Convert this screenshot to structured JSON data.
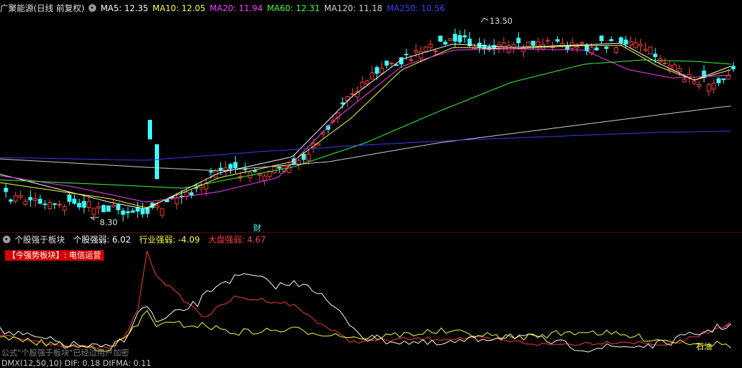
{
  "header": {
    "title": "广聚能源(日线 前复权)",
    "ma": [
      {
        "label": "MA5: 12.35",
        "color": "#ffffff"
      },
      {
        "label": "MA10: 12.05",
        "color": "#ffff3c"
      },
      {
        "label": "MA20: 11.94",
        "color": "#ff3cff"
      },
      {
        "label": "MA60: 12.31",
        "color": "#3cff3c"
      },
      {
        "label": "MA120: 11.18",
        "color": "#cfcfcf"
      },
      {
        "label": "MA250: 10.56",
        "color": "#3c3cff"
      }
    ]
  },
  "main_chart": {
    "high_label": "13.50",
    "low_label": "8.30",
    "event_marker": "财"
  },
  "sub_header": {
    "name": "个股强于板块",
    "items": [
      {
        "label": "个股强弱: 6.02",
        "color": "#ffffff"
      },
      {
        "label": "行业强弱: -4.09",
        "color": "#ffff3c"
      },
      {
        "label": "大盘强弱: 4.67",
        "color": "#ff3c3c"
      }
    ]
  },
  "sub_chart": {
    "badge": "【今强势板块】: 电信运营",
    "tag": "石油",
    "formula_note": "公式\"个股强于板块\"已经过用户加密"
  },
  "bottom": {
    "macd": "DMX(12,50,10)  DIF: 0.18  DIFMA: 0.11"
  },
  "colors": {
    "up": "#ff3c3c",
    "down": "#3cffff",
    "ma5": "#ffffff",
    "ma10": "#ffff3c",
    "ma20": "#ff3cff",
    "ma60": "#3cff3c",
    "ma120": "#cfcfcf",
    "ma250": "#3c3cff"
  }
}
